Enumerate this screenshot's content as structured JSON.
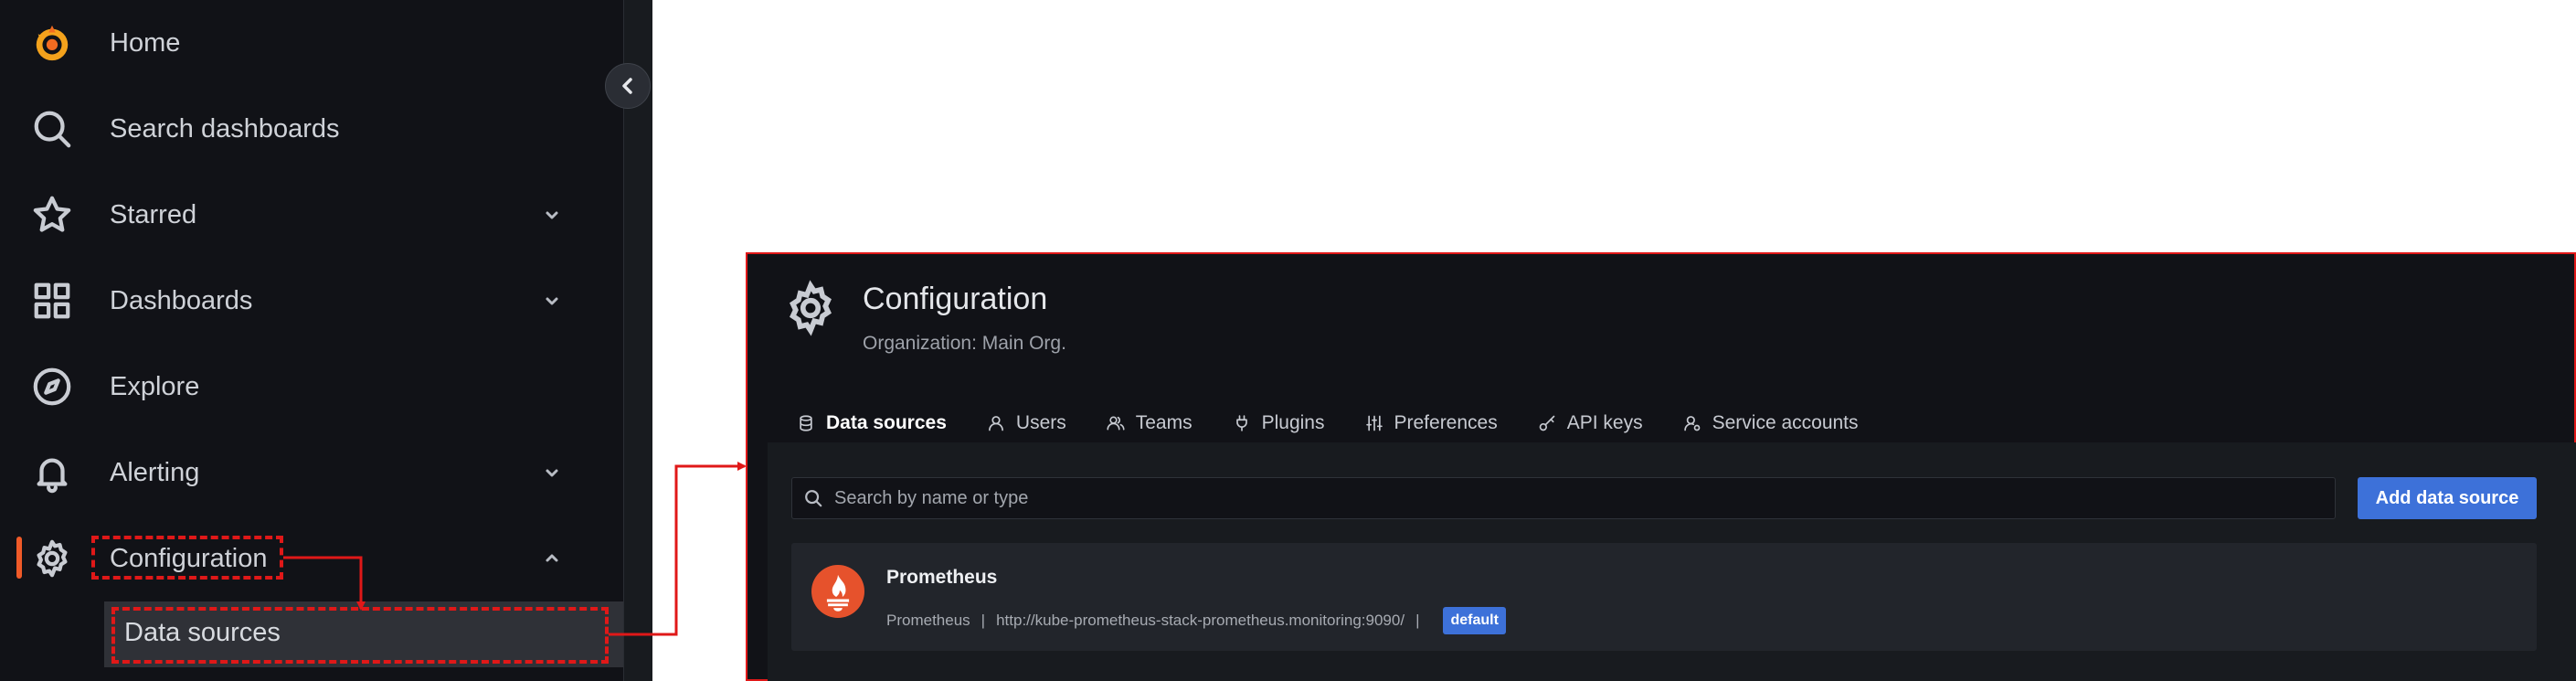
{
  "sidebar": {
    "items": [
      {
        "label": "Home",
        "icon": "grafana-logo-icon"
      },
      {
        "label": "Search dashboards",
        "icon": "search-icon"
      },
      {
        "label": "Starred",
        "icon": "star-icon",
        "expandable": true
      },
      {
        "label": "Dashboards",
        "icon": "apps-icon",
        "expandable": true
      },
      {
        "label": "Explore",
        "icon": "compass-icon"
      },
      {
        "label": "Alerting",
        "icon": "bell-icon",
        "expandable": true
      },
      {
        "label": "Configuration",
        "icon": "gear-icon",
        "expandable": true,
        "expanded": true,
        "active": true
      }
    ],
    "subitems": [
      {
        "label": "Data sources"
      }
    ],
    "accent_color": "#f05a28"
  },
  "page": {
    "title": "Configuration",
    "subtitle": "Organization: Main Org.",
    "tabs": [
      {
        "label": "Data sources",
        "icon": "database-icon",
        "active": true
      },
      {
        "label": "Users",
        "icon": "user-icon"
      },
      {
        "label": "Teams",
        "icon": "users-icon"
      },
      {
        "label": "Plugins",
        "icon": "plug-icon"
      },
      {
        "label": "Preferences",
        "icon": "sliders-icon"
      },
      {
        "label": "API keys",
        "icon": "key-icon"
      },
      {
        "label": "Service accounts",
        "icon": "user-cog-icon"
      }
    ],
    "search": {
      "placeholder": "Search by name or type",
      "value": ""
    },
    "add_button": "Add data source",
    "datasources": [
      {
        "name": "Prometheus",
        "type": "Prometheus",
        "separator": "|",
        "url": "http://kube-prometheus-stack-prometheus.monitoring:9090/",
        "badge": "default",
        "icon": "prometheus-logo-icon"
      }
    ]
  },
  "colors": {
    "annotation_red": "#e01818",
    "primary_blue": "#3d71d9",
    "prometheus_orange": "#e6522c"
  }
}
